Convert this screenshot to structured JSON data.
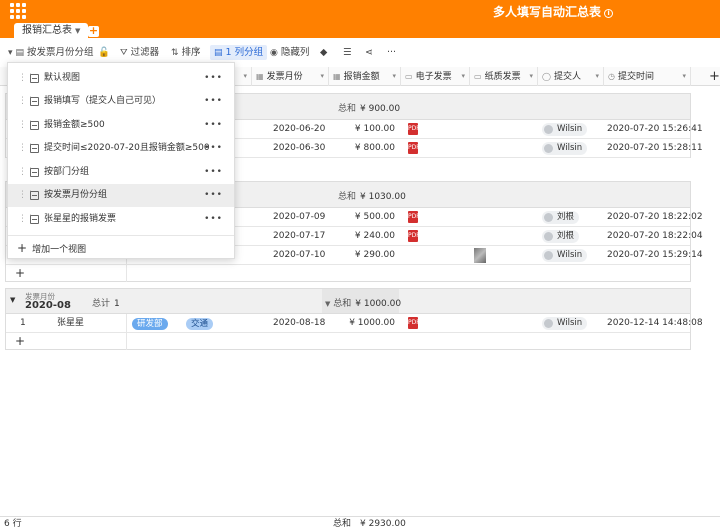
{
  "app": {
    "title": "多人填写自动汇总表",
    "info_icon": "info-icon",
    "active_tab": "报销汇总表"
  },
  "toolbar": {
    "view_label": "按发票月份分组",
    "filter": "过滤器",
    "sort": "排序",
    "group": "1 列分组",
    "hide": "隐藏列"
  },
  "columns": [
    "",
    "",
    "发票月份",
    "报销金额",
    "电子发票",
    "纸质发票",
    "提交人",
    "提交时间"
  ],
  "groups": [
    {
      "sum_label": "总和",
      "sum_value": "¥ 900.00",
      "rows": [
        {
          "date": "2020-06-20",
          "amount": "¥ 100.00",
          "user": "Wilsin",
          "time": "2020-07-20 15:26:41"
        },
        {
          "date": "2020-06-30",
          "amount": "¥ 800.00",
          "user": "Wilsin",
          "time": "2020-07-20 15:28:11"
        }
      ]
    },
    {
      "sum_label": "总和",
      "sum_value": "¥ 1030.00",
      "rows": [
        {
          "date": "2020-07-09",
          "amount": "¥ 500.00",
          "user": "刘根",
          "time": "2020-07-20 18:22:02"
        },
        {
          "date": "2020-07-17",
          "amount": "¥ 240.00",
          "user": "刘根",
          "time": "2020-07-20 18:22:04"
        },
        {
          "date": "2020-07-10",
          "amount": "¥ 290.00",
          "user": "Wilsin",
          "time": "2020-07-20 15:29:14"
        }
      ]
    },
    {
      "group_field": "发票月份",
      "group_value": "2020-08",
      "count_label": "总计",
      "count": "1",
      "sum_label": "总和",
      "sum_value": "¥ 1000.00",
      "rows": [
        {
          "index": "1",
          "name": "张星星",
          "dept": "研发部",
          "type": "交通",
          "date": "2020-08-18",
          "amount": "¥ 1000.00",
          "user": "Wilsin",
          "time": "2020-12-14 14:48:08"
        }
      ]
    }
  ],
  "menu": {
    "items": [
      "默认视图",
      "报销填写（提交人自己可见）",
      "报销金额≥500",
      "提交时间≤2020-07-20且报销金额≥500",
      "按部门分组",
      "按发票月份分组",
      "张星星的报销发票"
    ],
    "selected_index": 5,
    "add_label": "增加一个视图"
  },
  "footer": {
    "rows": "6 行",
    "sum_label": "总和",
    "sum_value": "¥ 2930.00"
  },
  "colors": {
    "brand": "#ff8000",
    "pdf": "#d32f2f",
    "dept_tag": "#6aa9ee",
    "type_tag": "#a9ccf5"
  }
}
